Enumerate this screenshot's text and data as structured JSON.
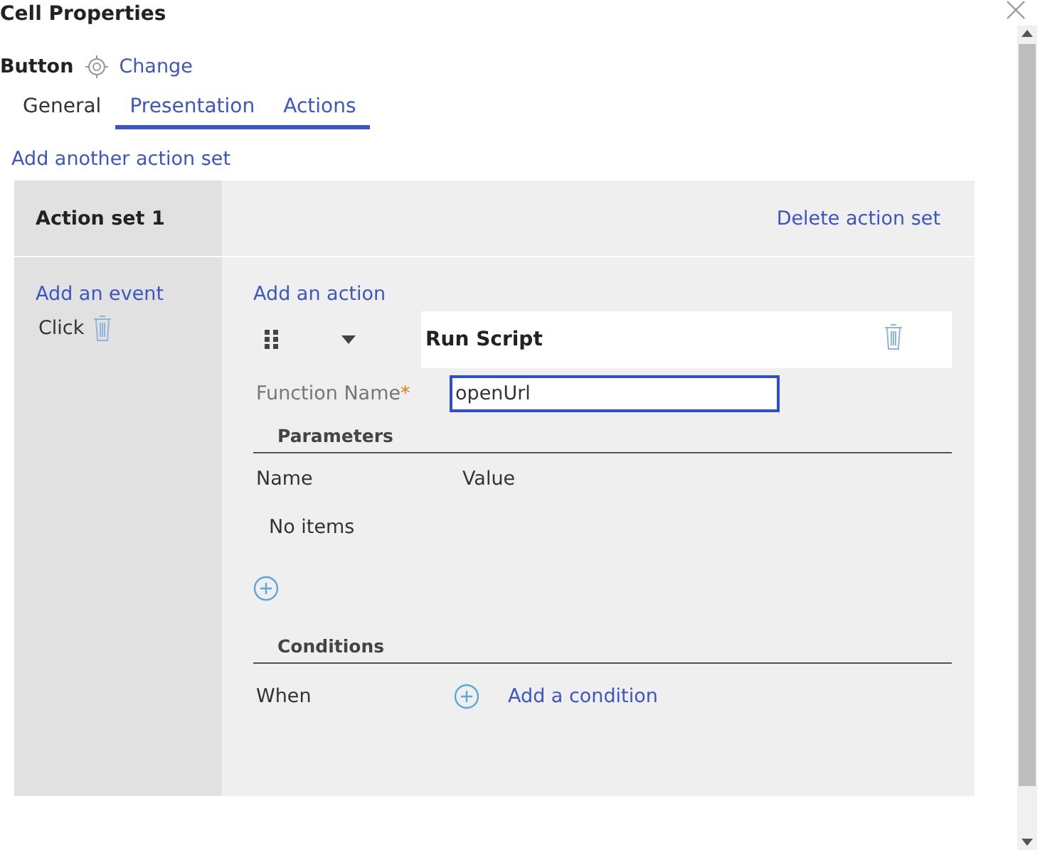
{
  "dialog": {
    "title": "Cell Properties"
  },
  "control": {
    "type": "Button",
    "change_link": "Change"
  },
  "tabs": [
    {
      "label": "General",
      "selected": false
    },
    {
      "label": "Presentation",
      "selected": true
    },
    {
      "label": "Actions",
      "selected": true
    }
  ],
  "add_action_set_link": "Add another action set",
  "action_set": {
    "title": "Action set 1",
    "delete_link": "Delete action set",
    "add_event_link": "Add an event",
    "events": [
      {
        "label": "Click"
      }
    ],
    "add_action_link": "Add an action",
    "action": {
      "title": "Run Script",
      "function_label": "Function Name",
      "required_mark": "*",
      "function_value": "openUrl",
      "parameters": {
        "heading": "Parameters",
        "columns": [
          "Name",
          "Value"
        ],
        "empty_text": "No items"
      },
      "conditions": {
        "heading": "Conditions",
        "when_label": "When",
        "add_condition_link": "Add a condition"
      }
    }
  }
}
